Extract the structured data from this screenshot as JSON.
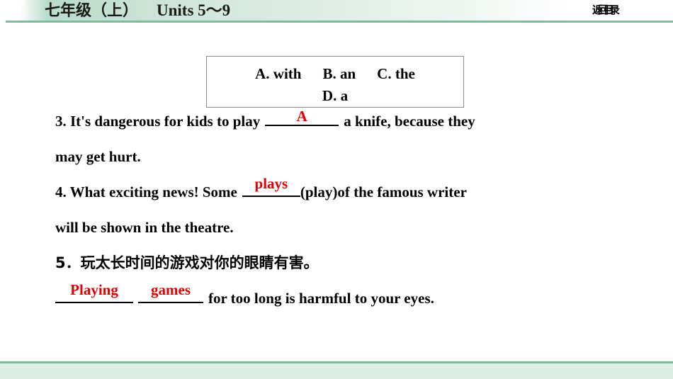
{
  "header": {
    "title_cn": "七年级（上）",
    "title_en": "Units 5～9",
    "return_label": "返回目录"
  },
  "options_box": {
    "line1_a": "A. with",
    "line1_b": "B. an",
    "line1_c": "C. the",
    "line2_d": "D. a"
  },
  "questions": [
    {
      "id": "q3",
      "line1_pre": "3. It's dangerous for kids to play",
      "answer": "A",
      "line1_post": "a knife, because they",
      "line2": "may get hurt."
    },
    {
      "id": "q4",
      "line1_pre": "4. What exciting news! Some",
      "answer": "plays",
      "line1_post": "(play)of the famous writer",
      "line2": "will be shown in the theatre."
    },
    {
      "id": "q5",
      "line1": "5．玩太长时间的游戏对你的眼睛有害。",
      "answer1": "Playing",
      "answer2": "games",
      "line2_post": "for too long is harmful to your eyes."
    }
  ],
  "colors": {
    "answer_red": "#e40000",
    "band_green": "#7bbd9a",
    "footer_green": "#dfeee5"
  }
}
